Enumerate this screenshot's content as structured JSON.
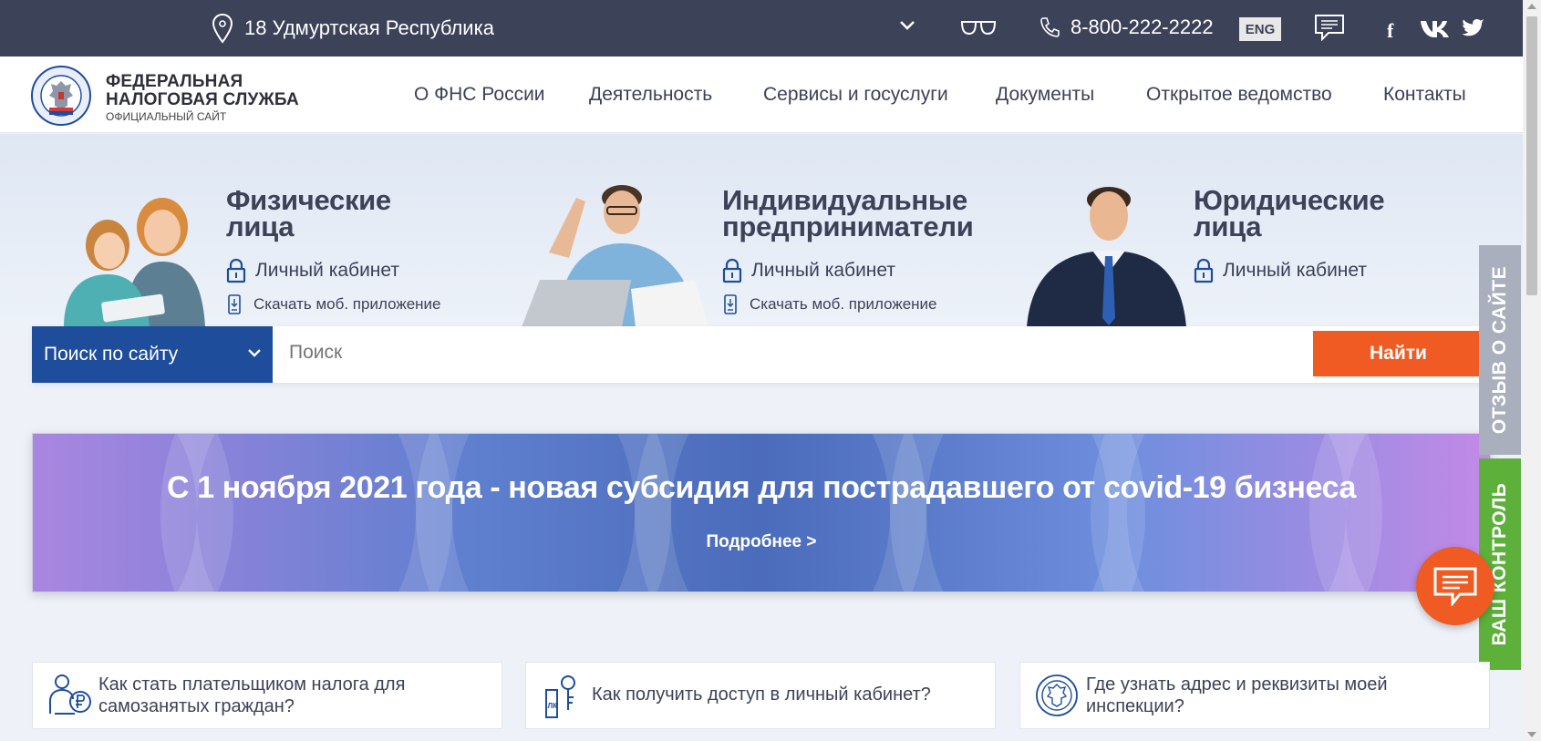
{
  "topbar": {
    "region": "18 Удмуртская Республика",
    "phone": "8-800-222-2222",
    "lang": "ENG",
    "icons": [
      "location-pin-icon",
      "chevron-down-icon",
      "glasses-icon",
      "phone-icon",
      "chat-icon",
      "facebook-icon",
      "vk-icon",
      "twitter-icon"
    ],
    "facebook_glyph": "f"
  },
  "header": {
    "brand_line1": "ФЕДЕРАЛЬНАЯ",
    "brand_line2": "НАЛОГОВАЯ СЛУЖБА",
    "brand_sub": "ОФИЦИАЛЬНЫЙ САЙТ",
    "nav": [
      "О ФНС России",
      "Деятельность",
      "Сервисы и госуслуги",
      "Документы",
      "Открытое ведомство",
      "Контакты"
    ]
  },
  "hero": {
    "cards": [
      {
        "title1": "Физические",
        "title2": "лица",
        "lk": "Личный кабинет",
        "app": "Скачать моб. приложение"
      },
      {
        "title1": "Индивидуальные",
        "title2": "предприниматели",
        "lk": "Личный кабинет",
        "app": "Скачать моб. приложение"
      },
      {
        "title1": "Юридические",
        "title2": "лица",
        "lk": "Личный кабинет"
      }
    ]
  },
  "search": {
    "scope": "Поиск по сайту",
    "placeholder": "Поиск",
    "button": "Найти"
  },
  "banner": {
    "title": "С 1 ноября 2021 года - новая субсидия для пострадавшего от covid-19 бизнеса",
    "more": "Подробнее >"
  },
  "side": {
    "review": "ОТЗЫВ О САЙТЕ",
    "control": "ВАШ КОНТРОЛЬ"
  },
  "info_cards": [
    {
      "line1": "Как стать плательщиком налога для",
      "line2": "самозанятых граждан?"
    },
    {
      "line1": "Как получить доступ в личный кабинет?",
      "line2": ""
    },
    {
      "line1": "Где узнать адрес и реквизиты моей",
      "line2": "инспекции?"
    }
  ],
  "colors": {
    "topbar": "#3c4257",
    "search_scope": "#1e4d9c",
    "accent": "#f05a23",
    "control_tab": "#5db03a",
    "review_tab": "#a9afbd"
  }
}
